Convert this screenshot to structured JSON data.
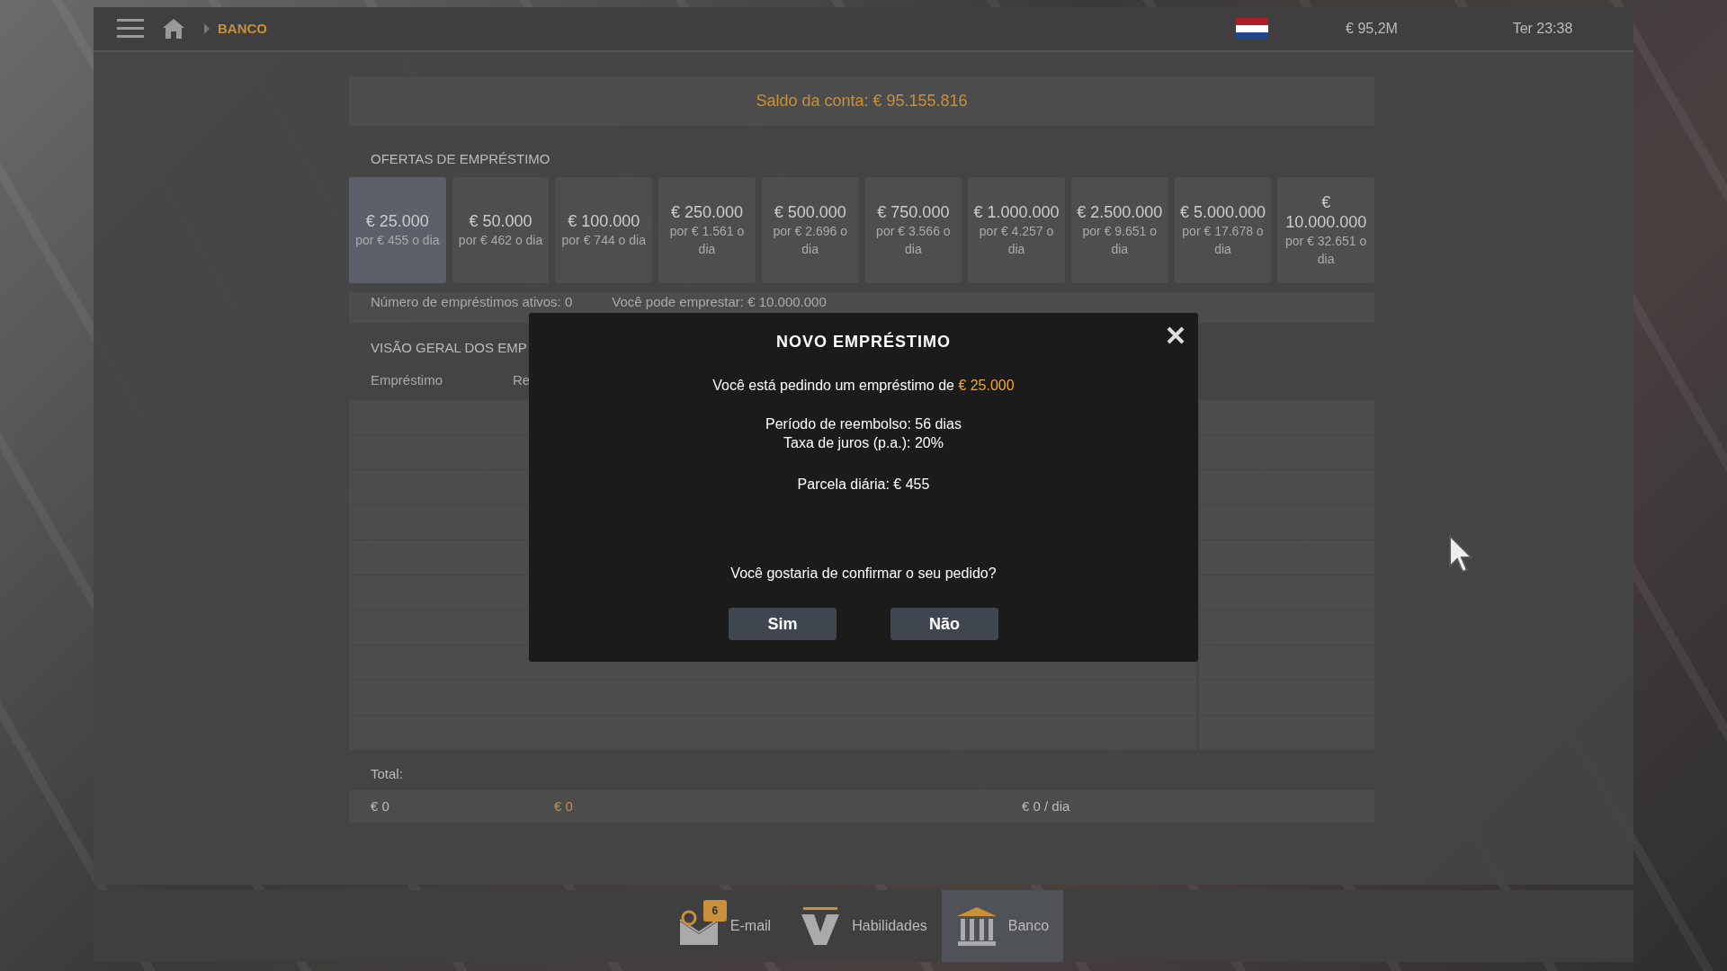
{
  "top_bar": {
    "breadcrumb": "BANCO",
    "balance": "€ 95,2M",
    "clock": "Ter 23:38"
  },
  "account_balance": "Saldo da conta: € 95.155.816",
  "offers_title": "OFERTAS DE EMPRÉSTIMO",
  "offers": [
    {
      "amount": "€ 25.000",
      "rate": "por € 455 o dia",
      "selected": true
    },
    {
      "amount": "€ 50.000",
      "rate": "por € 462 o dia",
      "selected": false
    },
    {
      "amount": "€ 100.000",
      "rate": "por € 744 o dia",
      "selected": false
    },
    {
      "amount": "€ 250.000",
      "rate": "por € 1.561 o dia",
      "selected": false
    },
    {
      "amount": "€ 500.000",
      "rate": "por € 2.696 o dia",
      "selected": false
    },
    {
      "amount": "€ 750.000",
      "rate": "por € 3.566 o dia",
      "selected": false
    },
    {
      "amount": "€ 1.000.000",
      "rate": "por € 4.257 o dia",
      "selected": false
    },
    {
      "amount": "€ 2.500.000",
      "rate": "por € 9.651 o dia",
      "selected": false
    },
    {
      "amount": "€ 5.000.000",
      "rate": "por € 17.678 o dia",
      "selected": false
    },
    {
      "amount": "€ 10.000.000",
      "rate": "por € 32.651 o dia",
      "selected": false
    }
  ],
  "stats": [
    "Número de empréstimos ativos: 0",
    "Você pode emprestar: € 10.000.000"
  ],
  "overview_title": "VISÃO GERAL DOS EMP",
  "table": {
    "columns": [
      "Empréstimo",
      "Re"
    ]
  },
  "totals": {
    "label": "Total:",
    "loan": "€ 0",
    "remaining": "€ 0",
    "daily": "€ 0 / dia"
  },
  "dialog": {
    "title": "NOVO EMPRÉSTIMO",
    "request": "Você está pedindo um empréstimo de ",
    "request_amount": "€ 25.000",
    "lines": [
      "Período de reembolso: 56 dias",
      "Taxa de juros (p.a.): 20%"
    ],
    "daily": "Parcela diária: € 455",
    "question": "Você gostaria de confirmar o seu pedido?",
    "buttons": [
      "Sim",
      "Não"
    ]
  },
  "taskbar": [
    {
      "kind": "email",
      "label": "E-mail",
      "badge": "6",
      "selected": false
    },
    {
      "kind": "skills",
      "label": "Habilidades",
      "selected": false
    },
    {
      "kind": "bank",
      "label": "Banco",
      "selected": true
    }
  ]
}
